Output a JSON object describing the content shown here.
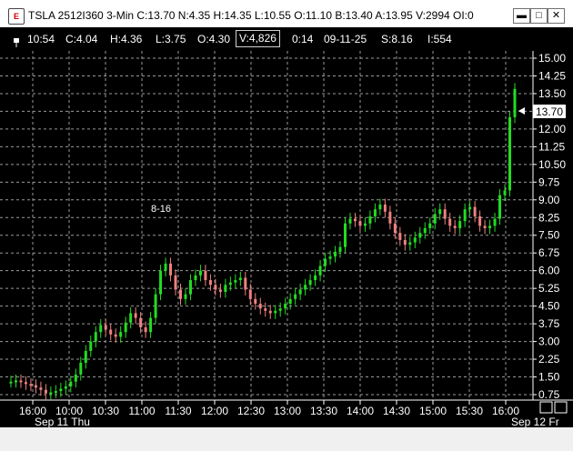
{
  "window": {
    "app_icon_glyph": "E",
    "title": "TSLA 2512I360 3-Min C:13.70 N:4.35 H:14.35 L:10.55 O:11.10 B:13.40 A:13.95 V:2994 OI:0",
    "minimize_glyph": "▬",
    "maximize_glyph": "□",
    "close_glyph": "✕"
  },
  "toolbar": {
    "time": "10:54",
    "close": "C:4.04",
    "high": "H:4.36",
    "low": "L:3.75",
    "open": "O:4.30",
    "volume": "V:4,826",
    "elapsed": "0:14",
    "date": "09-11-25",
    "s_value": "S:8.16",
    "i_value": "I:554"
  },
  "chart": {
    "price_label": "13.70",
    "annotation": "8-16",
    "y_ticks": [
      "15.00",
      "14.25",
      "13.50",
      "12.75",
      "12.00",
      "11.25",
      "10.50",
      "9.75",
      "9.00",
      "8.25",
      "7.50",
      "6.75",
      "6.00",
      "5.25",
      "4.50",
      "3.75",
      "3.00",
      "2.25",
      "1.50",
      "0.75"
    ],
    "x_ticks": [
      "16:00",
      "10:00",
      "10:30",
      "11:00",
      "11:30",
      "12:00",
      "12:30",
      "13:00",
      "13:30",
      "14:00",
      "14:30",
      "15:00",
      "15:30",
      "16:00"
    ],
    "date_labels": [
      "Sep 11 Thu",
      "Sep 12 Fr"
    ],
    "colors": {
      "up": "#22dd22",
      "down": "#f08080",
      "grid": "#9a9a9a",
      "text": "#ffffff",
      "background": "#000000"
    }
  },
  "chart_data": {
    "type": "candlestick",
    "title": "TSLA 2512I360 3-Min",
    "ylim": [
      0,
      15.4
    ],
    "y_ticks": [
      15.0,
      14.25,
      13.5,
      12.75,
      12.0,
      11.25,
      10.5,
      9.75,
      9.0,
      8.25,
      7.5,
      6.75,
      6.0,
      5.25,
      4.5,
      3.75,
      3.0,
      2.25,
      1.5,
      0.75
    ],
    "x_tick_labels": [
      "16:00",
      "10:00",
      "10:30",
      "11:00",
      "11:30",
      "12:00",
      "12:30",
      "13:00",
      "13:30",
      "14:00",
      "14:30",
      "15:00",
      "15:30",
      "16:00"
    ],
    "last_price": 13.7,
    "annotation": "8-16",
    "series": [
      {
        "name": "price",
        "values": [
          1.3,
          1.35,
          1.28,
          1.2,
          1.15,
          1.05,
          0.95,
          0.8,
          0.85,
          0.9,
          1.0,
          1.1,
          1.3,
          1.6,
          2.1,
          2.6,
          3.0,
          3.4,
          3.7,
          3.5,
          3.3,
          3.2,
          3.4,
          3.8,
          4.2,
          4.0,
          3.6,
          3.4,
          4.0,
          5.0,
          6.0,
          6.3,
          5.8,
          5.2,
          4.8,
          5.0,
          5.6,
          5.8,
          6.0,
          5.6,
          5.4,
          5.2,
          5.1,
          5.4,
          5.5,
          5.6,
          5.7,
          5.2,
          4.8,
          4.6,
          4.4,
          4.3,
          4.2,
          4.3,
          4.4,
          4.6,
          4.8,
          5.0,
          5.2,
          5.4,
          5.6,
          5.8,
          6.2,
          6.5,
          6.6,
          6.8,
          7.0,
          8.0,
          8.2,
          8.1,
          7.9,
          8.0,
          8.3,
          8.6,
          8.8,
          8.5,
          8.0,
          7.6,
          7.3,
          7.1,
          7.2,
          7.4,
          7.6,
          7.8,
          8.0,
          8.4,
          8.6,
          8.2,
          7.9,
          7.8,
          8.1,
          8.6,
          8.7,
          8.3,
          7.9,
          7.8,
          7.9,
          8.2,
          9.2,
          9.4,
          12.5,
          13.7
        ]
      }
    ]
  }
}
